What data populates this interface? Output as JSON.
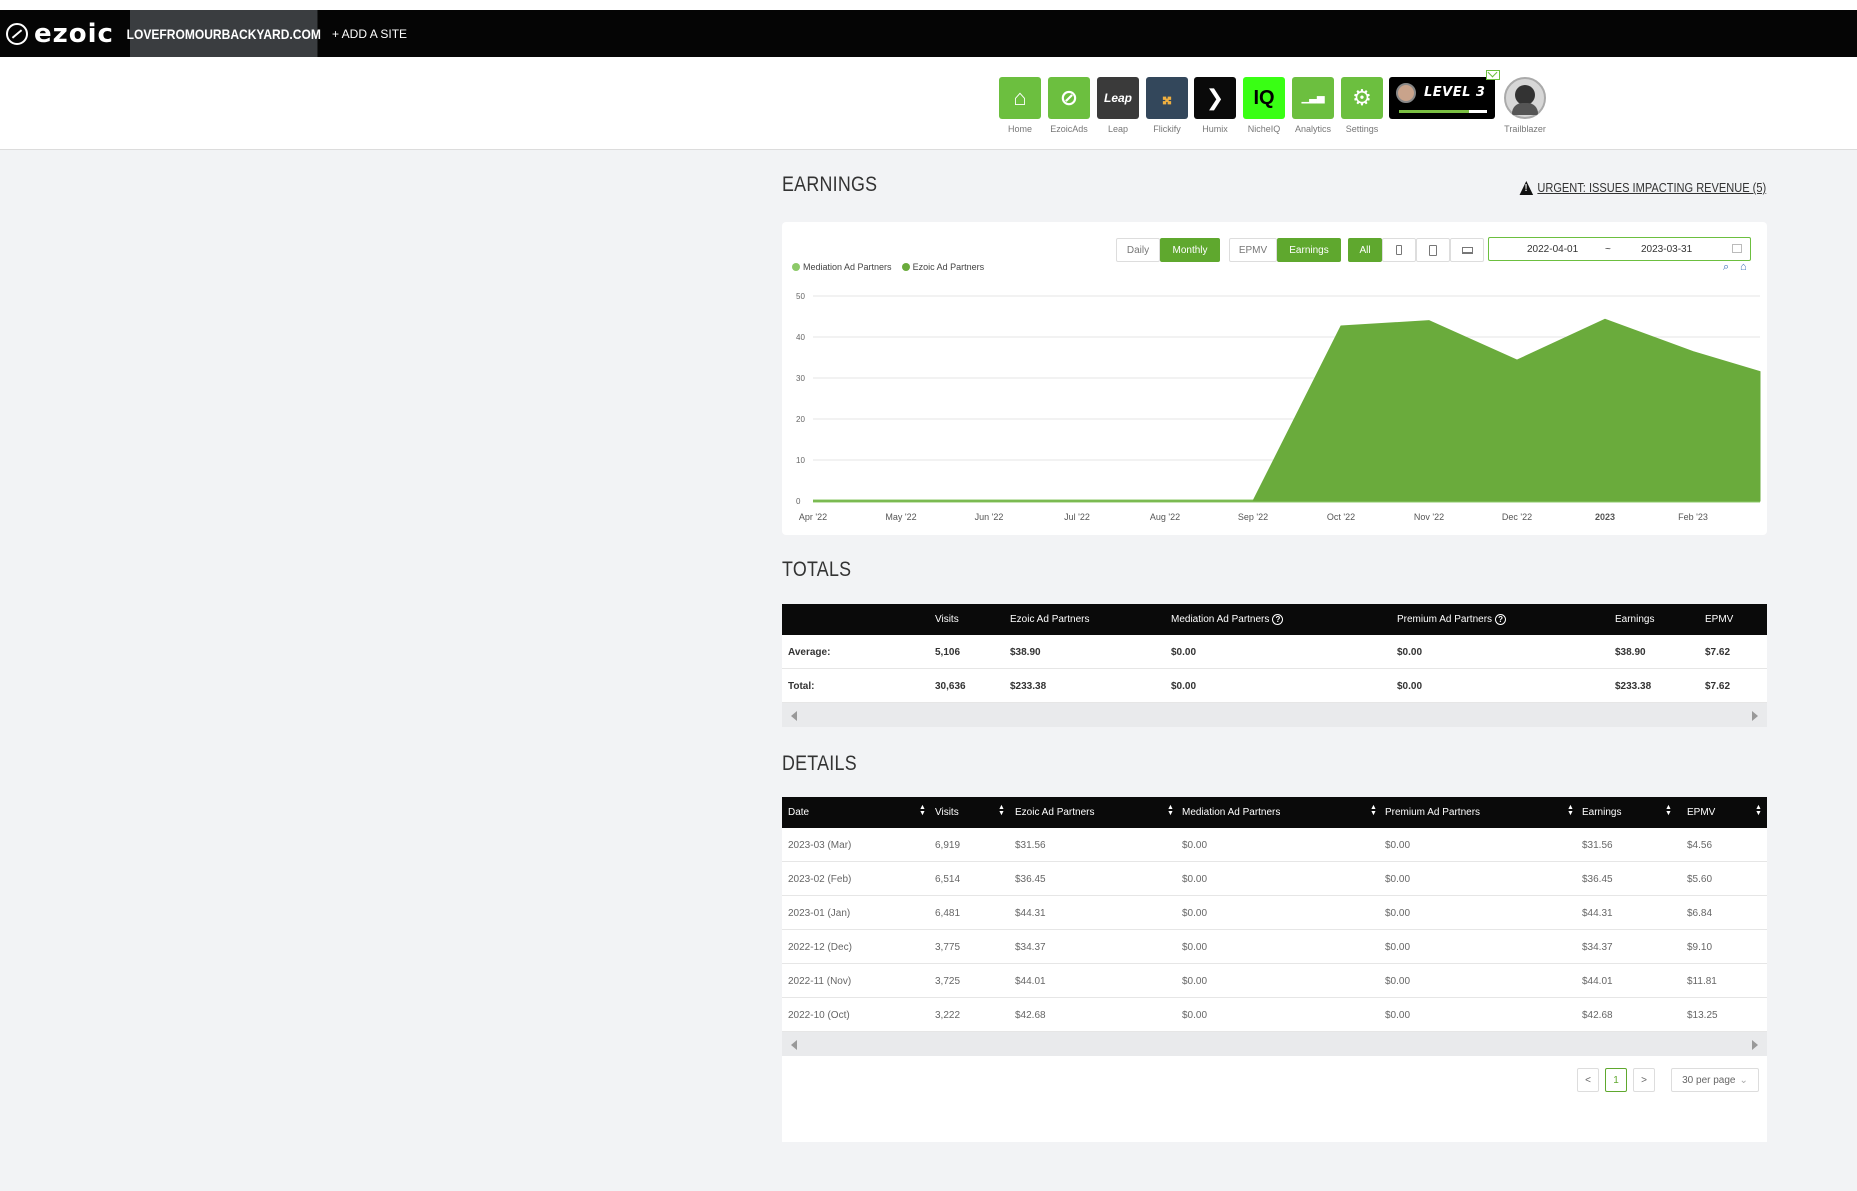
{
  "topbar": {
    "logo": "ezoic",
    "site": "LOVEFROMOURBACKYARD.COM",
    "add_site": "+ ADD A SITE"
  },
  "nav": [
    {
      "label": "Home",
      "icon": "house-icon",
      "color": "#6cbf3f"
    },
    {
      "label": "EzoicAds",
      "icon": "ezoic-logo-icon",
      "color": "#6cbf3f"
    },
    {
      "label": "Leap",
      "icon": "leap-logo-icon",
      "color": "#3a3a3a"
    },
    {
      "label": "Flickify",
      "icon": "flickify-logo-icon",
      "color": "#33475b"
    },
    {
      "label": "Humix",
      "icon": "humix-logo-icon",
      "color": "#0a0a0a"
    },
    {
      "label": "NicheIQ",
      "icon": "iq-icon",
      "color": "#39ff14"
    },
    {
      "label": "Analytics",
      "icon": "analytics-chart-icon",
      "color": "#6cbf3f"
    },
    {
      "label": "Settings",
      "icon": "gear-icon",
      "color": "#6cbf3f"
    }
  ],
  "level": {
    "text": "LEVEL 3",
    "progress": 0.8
  },
  "profile": {
    "label": "Trailblazer"
  },
  "earnings": {
    "title": "EARNINGS",
    "urgent": "URGENT: ISSUES IMPACTING REVENUE (5)",
    "buttons": {
      "daily": "Daily",
      "monthly": "Monthly",
      "epmv": "EPMV",
      "earnings": "Earnings",
      "all": "All"
    },
    "date_start": "2022-04-01",
    "date_sep": "~",
    "date_end": "2023-03-31"
  },
  "chart_data": {
    "type": "area",
    "x": [
      "Apr '22",
      "May '22",
      "Jun '22",
      "Jul '22",
      "Aug '22",
      "Sep '22",
      "Oct '22",
      "Nov '22",
      "Dec '22",
      "2023",
      "Feb '23",
      "Mar '23"
    ],
    "x_tick_labels": [
      "Apr '22",
      "May '22",
      "Jun '22",
      "Jul '22",
      "Aug '22",
      "Sep '22",
      "Oct '22",
      "Nov '22",
      "Dec '22",
      "2023",
      "Feb '23"
    ],
    "series": [
      {
        "name": "Mediation Ad Partners",
        "color": "#8cc968",
        "values": [
          0,
          0,
          0,
          0,
          0,
          0,
          0,
          0,
          0,
          0,
          0,
          0
        ]
      },
      {
        "name": "Ezoic Ad Partners",
        "color": "#6aab3c",
        "values": [
          0,
          0,
          0,
          0,
          0,
          0,
          42.68,
          44.01,
          34.37,
          44.31,
          36.45,
          31.56
        ]
      }
    ],
    "ylim": [
      0,
      50
    ],
    "y_ticks": [
      0,
      10,
      20,
      30,
      40,
      50
    ],
    "grid": true,
    "legend": "top-left"
  },
  "totals": {
    "title": "TOTALS",
    "headers": [
      "Visits",
      "Ezoic Ad Partners",
      "Mediation Ad Partners",
      "Premium Ad Partners",
      "Earnings",
      "EPMV"
    ],
    "rows": [
      {
        "label": "Average:",
        "cells": [
          "5,106",
          "$38.90",
          "$0.00",
          "$0.00",
          "$38.90",
          "$7.62"
        ]
      },
      {
        "label": "Total:",
        "cells": [
          "30,636",
          "$233.38",
          "$0.00",
          "$0.00",
          "$233.38",
          "$7.62"
        ]
      }
    ]
  },
  "details": {
    "title": "DETAILS",
    "headers": [
      "Date",
      "Visits",
      "Ezoic Ad Partners",
      "Mediation Ad Partners",
      "Premium Ad Partners",
      "Earnings",
      "EPMV"
    ],
    "rows": [
      [
        "2023-03 (Mar)",
        "6,919",
        "$31.56",
        "$0.00",
        "$0.00",
        "$31.56",
        "$4.56"
      ],
      [
        "2023-02 (Feb)",
        "6,514",
        "$36.45",
        "$0.00",
        "$0.00",
        "$36.45",
        "$5.60"
      ],
      [
        "2023-01 (Jan)",
        "6,481",
        "$44.31",
        "$0.00",
        "$0.00",
        "$44.31",
        "$6.84"
      ],
      [
        "2022-12 (Dec)",
        "3,775",
        "$34.37",
        "$0.00",
        "$0.00",
        "$34.37",
        "$9.10"
      ],
      [
        "2022-11 (Nov)",
        "3,725",
        "$44.01",
        "$0.00",
        "$0.00",
        "$44.01",
        "$11.81"
      ],
      [
        "2022-10 (Oct)",
        "3,222",
        "$42.68",
        "$0.00",
        "$0.00",
        "$42.68",
        "$13.25"
      ]
    ],
    "pagination": {
      "prev": "<",
      "page": "1",
      "next": ">",
      "per_page": "30 per page"
    }
  }
}
